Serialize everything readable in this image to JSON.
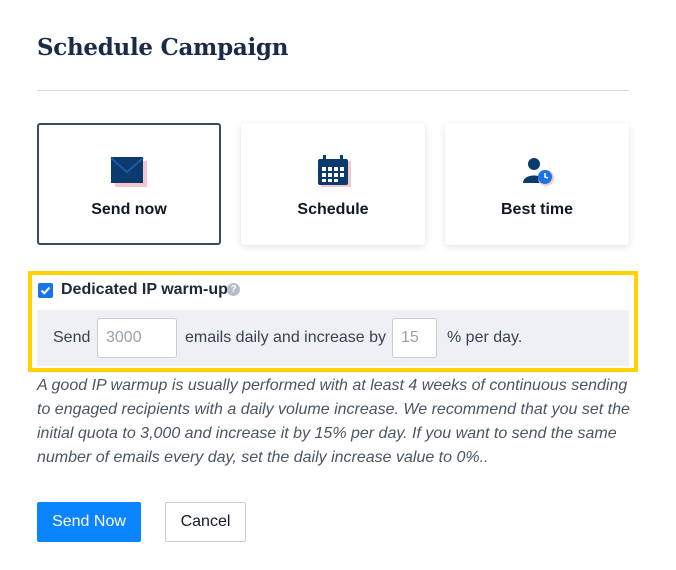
{
  "header": {
    "title": "Schedule Campaign"
  },
  "options": [
    {
      "label": "Send now",
      "icon": "envelope-icon",
      "selected": true
    },
    {
      "label": "Schedule",
      "icon": "calendar-icon",
      "selected": false
    },
    {
      "label": "Best time",
      "icon": "user-clock-icon",
      "selected": false
    }
  ],
  "warmup": {
    "checked": true,
    "label": "Dedicated IP warm-up",
    "help_icon": "question-circle-icon",
    "send_label": "Send",
    "daily_value": "3000",
    "middle_label": "emails daily and increase by",
    "increase_value": "15",
    "suffix_label": "% per day.",
    "highlight_color": "#ffd200"
  },
  "help_text": "A good IP warmup is usually performed with at least 4 weeks of continuous sending to engaged recipients with a daily volume increase. We recommend that you set the initial quota to 3,000 and increase it by 15% per day. If you want to send the same number of emails every day, set the daily increase value to 0%..",
  "actions": {
    "primary_label": "Send Now",
    "cancel_label": "Cancel",
    "primary_color": "#0a84ff"
  }
}
